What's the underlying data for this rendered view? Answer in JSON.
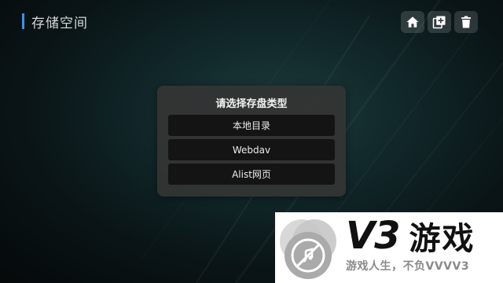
{
  "header": {
    "title": "存储空间"
  },
  "toolbar": {
    "icons": [
      "home-icon",
      "add-icon",
      "trash-icon"
    ]
  },
  "dialog": {
    "title": "请选择存盘类型",
    "options": [
      {
        "label": "本地目录"
      },
      {
        "label": "Webdav"
      },
      {
        "label": "Alist网页"
      }
    ]
  },
  "watermark": {
    "brand_v3": "V3",
    "brand_game": "游戏",
    "slogan": "游戏人生，不负VVVV3"
  },
  "colors": {
    "accent": "#3a93e6",
    "dialog_bg": "#343434",
    "option_bg": "#141414"
  }
}
